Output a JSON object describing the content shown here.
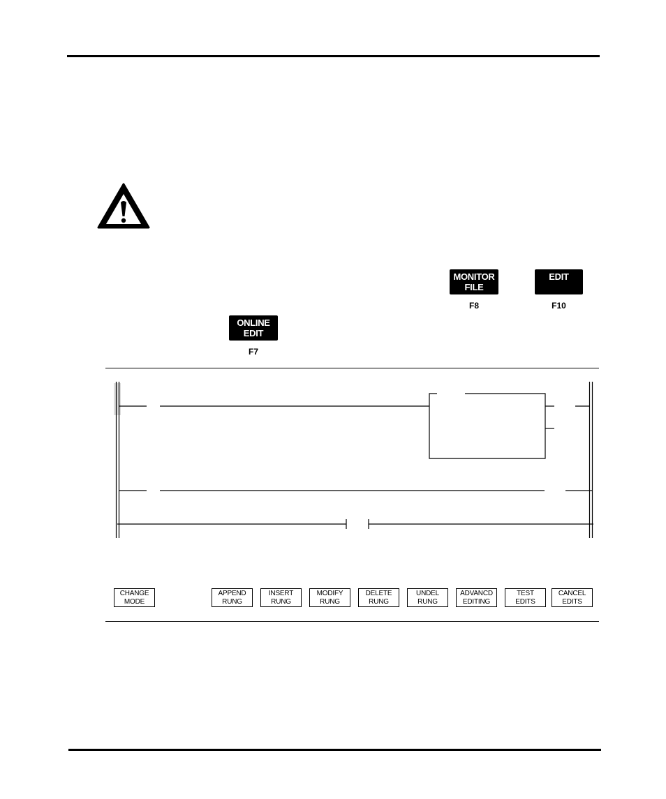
{
  "page": {
    "warning_icon": "warning-triangle-icon"
  },
  "keys": {
    "monitor_file": {
      "line1": "MONITOR",
      "line2": "FILE",
      "fkey": "F8"
    },
    "edit": {
      "line1": "EDIT",
      "line2": "",
      "fkey": "F10"
    },
    "online_edit": {
      "line1": "ONLINE",
      "line2": "EDIT",
      "fkey": "F7"
    }
  },
  "screen": {
    "softkeys": [
      {
        "line1": "CHANGE",
        "line2": "MODE"
      },
      {
        "line1": "APPEND",
        "line2": "RUNG"
      },
      {
        "line1": "INSERT",
        "line2": "RUNG"
      },
      {
        "line1": "MODIFY",
        "line2": "RUNG"
      },
      {
        "line1": "DELETE",
        "line2": "RUNG"
      },
      {
        "line1": "UNDEL",
        "line2": "RUNG"
      },
      {
        "line1": "ADVANCD",
        "line2": "EDITING"
      },
      {
        "line1": "TEST",
        "line2": "EDITS"
      },
      {
        "line1": "CANCEL",
        "line2": "EDITS"
      }
    ]
  }
}
